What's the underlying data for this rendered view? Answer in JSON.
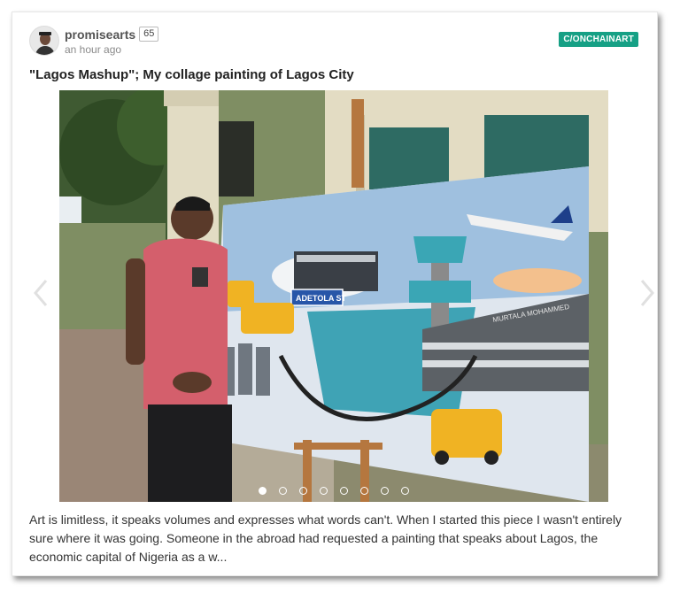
{
  "post": {
    "author": "promisearts",
    "reputation": "65",
    "time": "an hour ago",
    "community": "C/ONCHAINART",
    "title": "\"Lagos Mashup\"; My collage painting of Lagos City",
    "excerpt": "Art is limitless, it speaks volumes and expresses what words can't. When I started this piece I wasn't entirely sure where it was going. Someone in the abroad had requested a painting that speaks about Lagos, the economic capital of Nigeria as a w..."
  },
  "painting": {
    "sign_text": "ADETOLA ST",
    "building_text": "MURTALA MOHAMMED"
  },
  "carousel": {
    "total_slides": 8,
    "active_index": 0
  },
  "icons": {
    "prev": "chevron-left-icon",
    "next": "chevron-right-icon"
  },
  "colors": {
    "community_badge": "#16a085",
    "author": "#555555",
    "time": "#8a8a8a"
  }
}
